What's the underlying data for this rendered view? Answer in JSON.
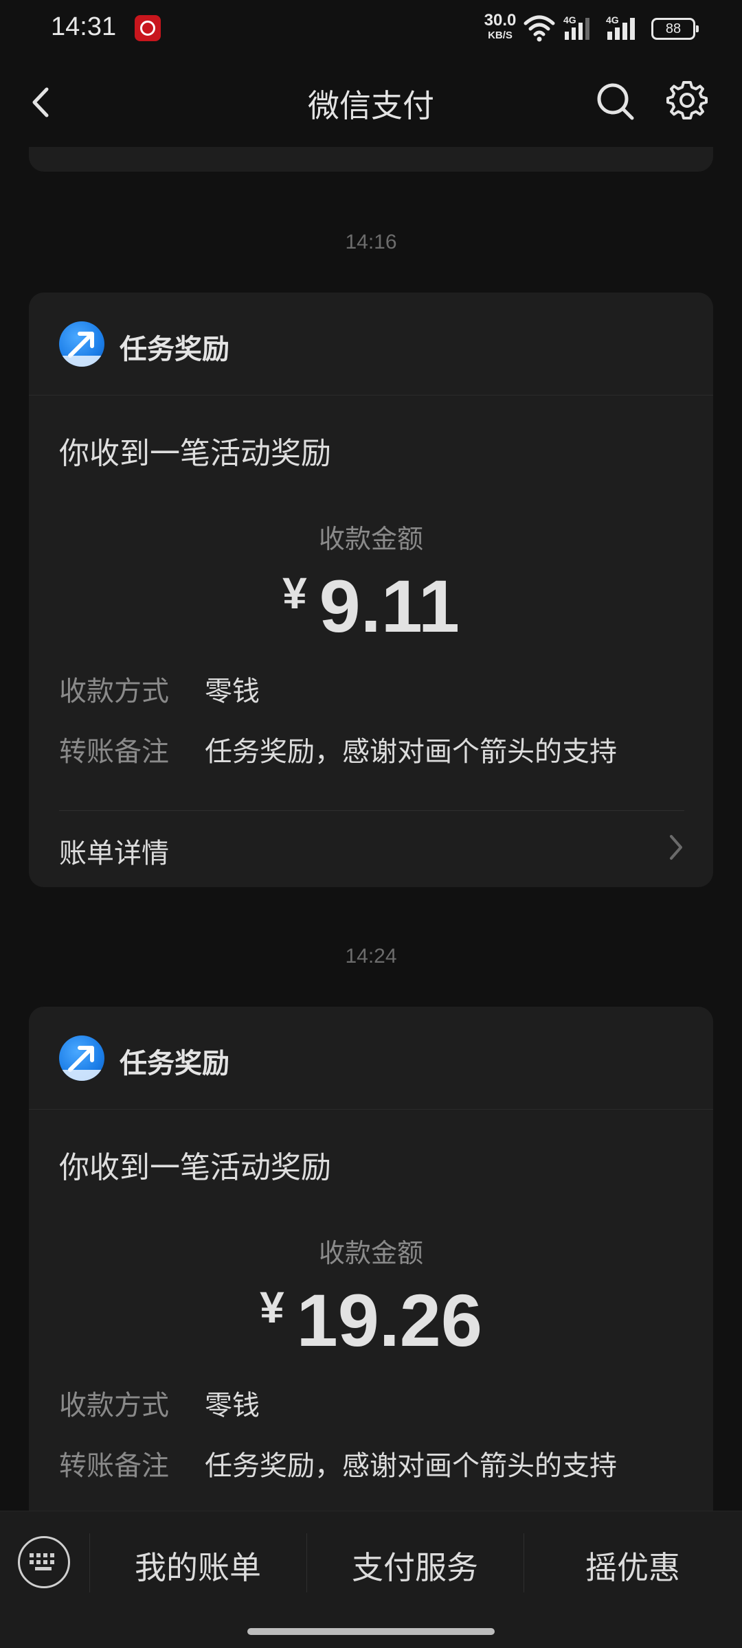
{
  "status_bar": {
    "time": "14:31",
    "net_speed_value": "30.0",
    "net_speed_unit": "KB/S",
    "network_1": "4G",
    "network_2": "4G",
    "battery": "88"
  },
  "nav": {
    "title": "微信支付",
    "icons": [
      "back-icon",
      "search-icon",
      "settings-icon"
    ]
  },
  "messages": [
    {
      "timestamp": "14:16",
      "header_title": "任务奖励",
      "message": "你收到一笔活动奖励",
      "amount_label": "收款金额",
      "currency": "¥",
      "amount": "9.11",
      "method_label": "收款方式",
      "method_value": "零钱",
      "note_label": "转账备注",
      "note_value": "任务奖励，感谢对画个箭头的支持",
      "detail_label": "账单详情"
    },
    {
      "timestamp": "14:24",
      "header_title": "任务奖励",
      "message": "你收到一笔活动奖励",
      "amount_label": "收款金额",
      "currency": "¥",
      "amount": "19.26",
      "method_label": "收款方式",
      "method_value": "零钱",
      "note_label": "转账备注",
      "note_value": "任务奖励，感谢对画个箭头的支持"
    }
  ],
  "bottom_menu": {
    "items": [
      "我的账单",
      "支付服务",
      "摇优惠"
    ]
  },
  "colors": {
    "background": "#111111",
    "card": "#1e1e1e",
    "text_primary": "#dcdcdc",
    "text_secondary": "#8a8a8a",
    "avatar_blue": "#1c7ee8"
  }
}
